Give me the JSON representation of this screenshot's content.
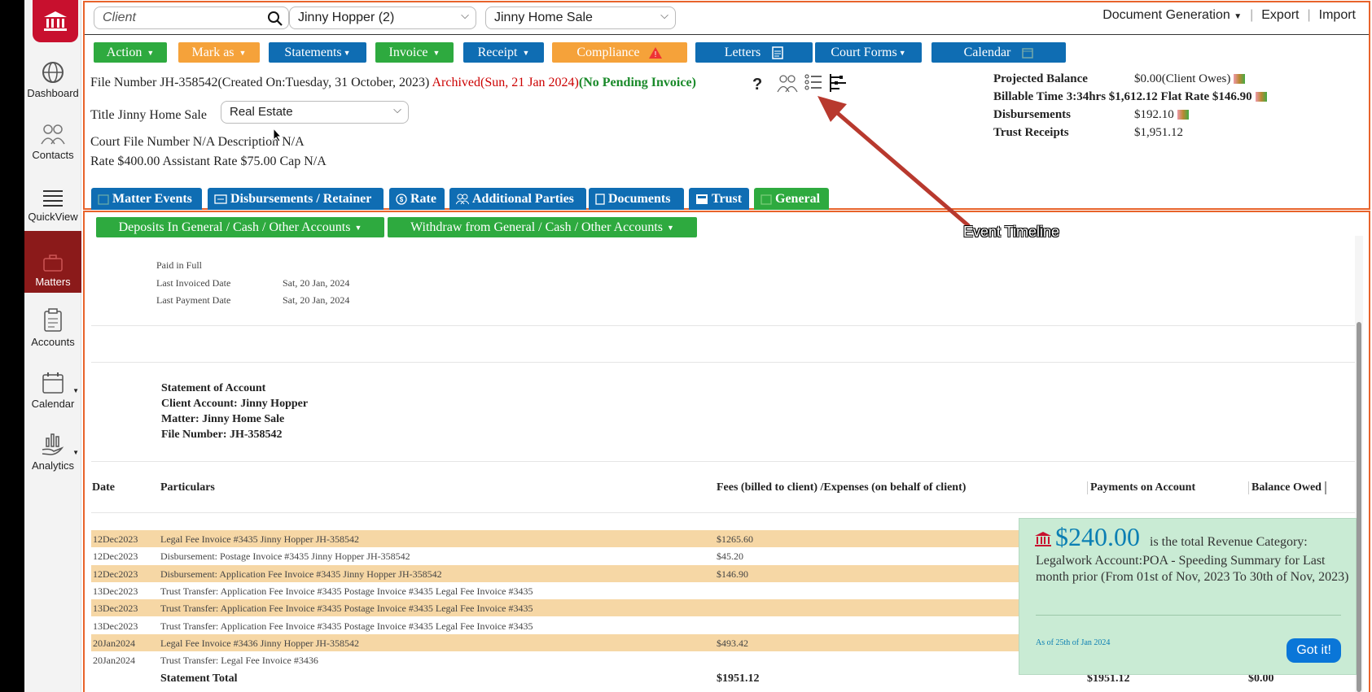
{
  "sidebar": {
    "items": [
      {
        "label": "Dashboard"
      },
      {
        "label": "Contacts"
      },
      {
        "label": "QuickView"
      },
      {
        "label": "Matters"
      },
      {
        "label": "Accounts"
      },
      {
        "label": "Calendar"
      },
      {
        "label": "Analytics"
      }
    ]
  },
  "topbar": {
    "client_placeholder": "Client",
    "client_select": "Jinny Hopper (2)",
    "matter_select": "Jinny Home Sale",
    "document_generation": "Document Generation",
    "export": "Export",
    "import": "Import"
  },
  "actions": {
    "action": "Action",
    "mark_as": "Mark as",
    "statements": "Statements",
    "invoice": "Invoice",
    "receipt": "Receipt",
    "compliance": "Compliance",
    "letters": "Letters",
    "court_forms": "Court Forms",
    "calendar": "Calendar"
  },
  "matter": {
    "file_number_label": "File Number",
    "file_number": "JH-358542",
    "created_on": "(Created On:Tuesday, 31 October, 2023)",
    "archived": "Archived(Sun, 21 Jan 2024)",
    "pending_invoice": "(No Pending Invoice)",
    "help": "?",
    "title_label": "Title",
    "title": "Jinny Home Sale",
    "category": "Real Estate",
    "court_file_label": "Court File Number",
    "court_file": "N/A",
    "description_label": "Description",
    "description": "N/A",
    "rate_label": "Rate",
    "rate": "$400.00",
    "assistant_rate_label": "Assistant Rate",
    "assistant_rate": "$75.00",
    "cap_label": "Cap",
    "cap": "N/A"
  },
  "summary": {
    "projected_balance_label": "Projected Balance",
    "projected_balance": "$0.00(Client Owes)",
    "billable_time_label": "Billable Time",
    "billable_time": "3:34hrs $1,612.12 Flat Rate $146.90",
    "disbursements_label": "Disbursements",
    "disbursements": "$192.10",
    "trust_receipts_label": "Trust Receipts",
    "trust_receipts": "$1,951.12"
  },
  "tabs": [
    {
      "label": "Matter Events"
    },
    {
      "label": "Disbursements / Retainer"
    },
    {
      "label": "Rate"
    },
    {
      "label": "Additional Parties"
    },
    {
      "label": "Documents"
    },
    {
      "label": "Trust"
    },
    {
      "label": "General"
    }
  ],
  "general": {
    "deposits": "Deposits In General / Cash / Other Accounts",
    "withdraw": "Withdraw from General / Cash / Other Accounts",
    "paid_in_full": "Paid in Full",
    "last_invoiced_label": "Last Invoiced Date",
    "last_invoiced": "Sat, 20 Jan, 2024",
    "last_payment_label": "Last Payment Date",
    "last_payment": "Sat, 20 Jan, 2024"
  },
  "statement": {
    "title": "Statement of Account",
    "client": "Client Account: Jinny Hopper",
    "matter": "Matter: Jinny Home Sale",
    "file_number": "File Number: JH-358542",
    "headers": {
      "date": "Date",
      "particulars": "Particulars",
      "fees": "Fees (billed to client) /Expenses (on behalf of client)",
      "payments": "Payments on Account",
      "balance": "Balance Owed"
    },
    "rows": [
      {
        "date": "12Dec2023",
        "particulars": "Legal Fee Invoice #3435 Jinny Hopper JH-358542",
        "fees": "$1265.60"
      },
      {
        "date": "12Dec2023",
        "particulars": "Disbursement: Postage Invoice #3435 Jinny Hopper JH-358542",
        "fees": "$45.20"
      },
      {
        "date": "12Dec2023",
        "particulars": "Disbursement: Application Fee Invoice #3435 Jinny Hopper JH-358542",
        "fees": "$146.90"
      },
      {
        "date": "13Dec2023",
        "particulars": "Trust Transfer: Application Fee Invoice #3435 Postage Invoice #3435 Legal Fee Invoice #3435",
        "fees": ""
      },
      {
        "date": "13Dec2023",
        "particulars": "Trust Transfer: Application Fee Invoice #3435 Postage Invoice #3435 Legal Fee Invoice #3435",
        "fees": ""
      },
      {
        "date": "13Dec2023",
        "particulars": "Trust Transfer: Application Fee Invoice #3435 Postage Invoice #3435 Legal Fee Invoice #3435",
        "fees": ""
      },
      {
        "date": "20Jan2024",
        "particulars": "Legal Fee Invoice #3436 Jinny Hopper JH-358542",
        "fees": "$493.42"
      },
      {
        "date": "20Jan2024",
        "particulars": "Trust Transfer: Legal Fee Invoice #3436",
        "fees": ""
      }
    ],
    "total_label": "Statement Total",
    "total_fees": "$1951.12",
    "total_payments": "$1951.12",
    "total_balance": "$0.00"
  },
  "popup": {
    "amount": "$240.00",
    "text1": "is the total Revenue Category:",
    "text2": "Legalwork Account:POA - Speeding Summary for Last month prior (From 01st of Nov, 2023 To 30th of Nov, 2023)",
    "as_of": "As of 25th of Jan 2024",
    "got_it": "Got it!"
  },
  "annotation": "Event Timeline",
  "colors": {
    "accent_red": "#c8102e",
    "green": "#2eaa3f",
    "orange": "#f5a23a",
    "blue": "#0f6db3",
    "frame": "#e8632b"
  }
}
